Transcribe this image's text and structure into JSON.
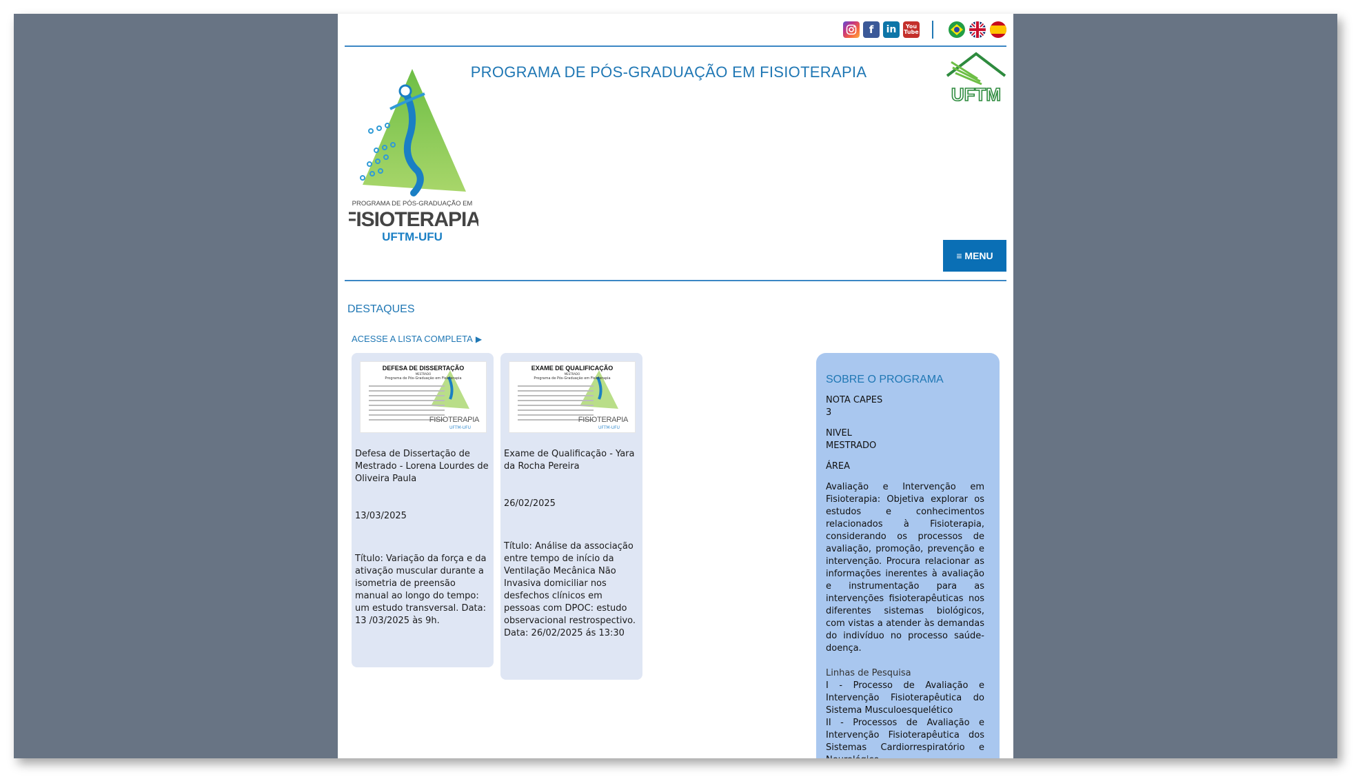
{
  "social": {
    "instagram_icon": "instagram-icon",
    "facebook_icon": "facebook-icon",
    "linkedin_icon": "linkedin-icon",
    "youtube_icon": "youtube-icon",
    "youtube_top": "You",
    "youtube_bottom": "Tube"
  },
  "languages": {
    "flags": [
      "brazil-flag-icon",
      "uk-flag-icon",
      "spain-flag-icon"
    ]
  },
  "header": {
    "program_title": "PROGRAMA DE PÓS-GRADUAÇÃO EM FISIOTERAPIA",
    "logo_line1": "PROGRAMA DE PÓS-GRADUAÇÃO EM",
    "logo_line2": "FISIOTERAPIA",
    "logo_line3": "UFTM-UFU",
    "uftm_logo_text": "UFTM",
    "menu_label": "≡ MENU"
  },
  "highlights": {
    "section_title": "DESTAQUES",
    "full_list_link": "ACESSE A LISTA COMPLETA",
    "cards": [
      {
        "thumb_title": "DEFESA DE DISSERTAÇÃO",
        "thumb_sub1": "MESTRADO",
        "thumb_sub2": "Programa de Pós-Graduação em Fisioterapia",
        "thumb_wm": "FISIOTERAPIA",
        "thumb_wm2": "UFTM-UFU",
        "title": "Defesa de Dissertação de Mestrado - Lorena Lourdes de Oliveira Paula",
        "date": "13/03/2025",
        "description": "Título: Variação da força e da ativação muscular durante a isometria de preensão manual ao longo do tempo: um estudo transversal.  Data: 13 /03/2025 às 9h."
      },
      {
        "thumb_title": "EXAME DE QUALIFICAÇÃO",
        "thumb_sub1": "MESTRADO",
        "thumb_sub2": "Programa de Pós-Graduação em Fisioterapia",
        "thumb_wm": "FISIOTERAPIA",
        "thumb_wm2": "UFTM-UFU",
        "title": "Exame de Qualificação - Yara da Rocha Pereira",
        "date": "26/02/2025",
        "description": "Título: Análise da associação entre tempo de início da Ventilação Mecânica Não Invasiva domiciliar nos desfechos clínicos em pessoas com DPOC: estudo observacional restrospectivo. Data: 26/02/2025 ás 13:30"
      }
    ]
  },
  "sobre": {
    "title": "SOBRE O PROGRAMA",
    "nota_label": "NOTA CAPES",
    "nota_value": "3",
    "nivel_label": "NIVEL",
    "nivel_value": "MESTRADO",
    "area_label": "ÁREA",
    "area_text": "Avaliação e Intervenção em Fisioterapia: Objetiva explorar os estudos e conhecimentos relacionados à Fisioterapia, considerando os processos de avaliação, promoção, prevenção e intervenção. Procura relacionar as informações inerentes à avaliação e instrumentação para as intervenções fisioterapêuticas nos diferentes sistemas biológicos, com vistas a atender às demandas do indivíduo no processo saúde-doença.",
    "linhas_label": "Linhas de Pesquisa",
    "linha1": "I - Processo de Avaliação e Intervenção Fisioterapêutica do Sistema Musculoesquelético",
    "linha2": "II - Processos de Avaliação e Intervenção Fisioterapêutica dos Sistemas Cardiorrespiratório e Neurológico"
  }
}
